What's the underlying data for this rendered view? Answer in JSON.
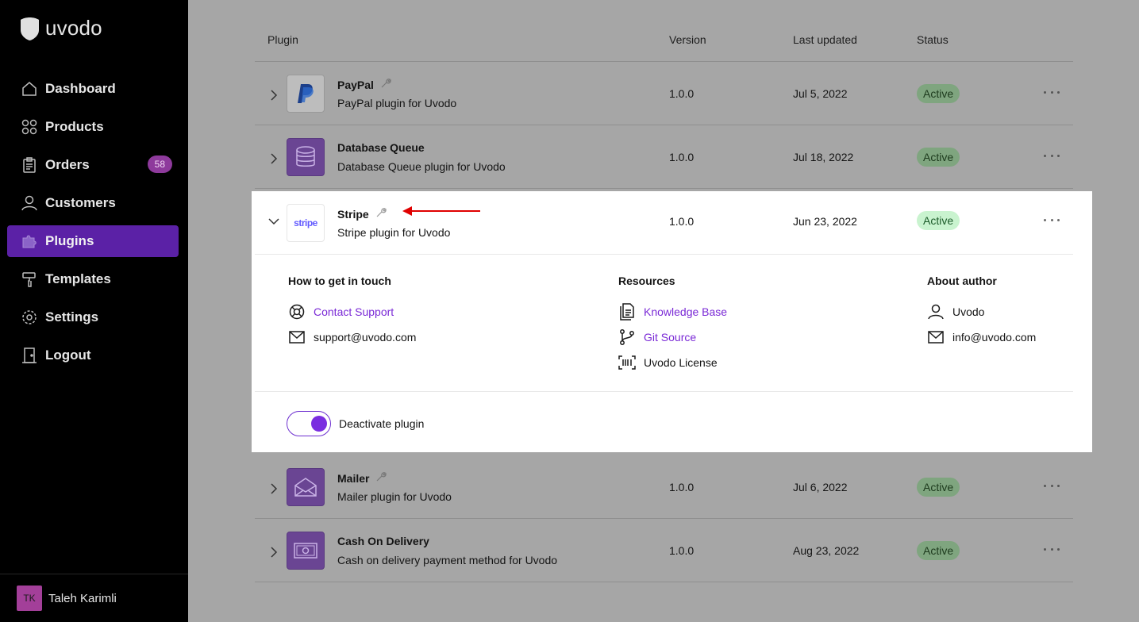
{
  "brand": {
    "name": "uvodo"
  },
  "nav": [
    {
      "label": "Dashboard",
      "icon": "home-icon"
    },
    {
      "label": "Products",
      "icon": "grid-icon"
    },
    {
      "label": "Orders",
      "icon": "clipboard-icon",
      "badge": "58"
    },
    {
      "label": "Customers",
      "icon": "user-icon"
    },
    {
      "label": "Plugins",
      "icon": "puzzle-icon",
      "active": true
    },
    {
      "label": "Templates",
      "icon": "paint-roller-icon"
    },
    {
      "label": "Settings",
      "icon": "gear-icon"
    },
    {
      "label": "Logout",
      "icon": "door-icon"
    }
  ],
  "user": {
    "initials": "TK",
    "name": "Taleh Karimli"
  },
  "table": {
    "headers": {
      "plugin": "Plugin",
      "version": "Version",
      "updated": "Last updated",
      "status": "Status"
    }
  },
  "plugins": [
    {
      "name": "PayPal",
      "desc": "PayPal plugin for Uvodo",
      "version": "1.0.0",
      "updated": "Jul 5, 2022",
      "status": "Active"
    },
    {
      "name": "Database Queue",
      "desc": "Database Queue plugin for Uvodo",
      "version": "1.0.0",
      "updated": "Jul 18, 2022",
      "status": "Active"
    },
    {
      "name": "Stripe",
      "desc": "Stripe plugin for Uvodo",
      "version": "1.0.0",
      "updated": "Jun 23, 2022",
      "status": "Active",
      "logo_text": "stripe"
    },
    {
      "name": "Mailer",
      "desc": "Mailer plugin for Uvodo",
      "version": "1.0.0",
      "updated": "Jul 6, 2022",
      "status": "Active"
    },
    {
      "name": "Cash On Delivery",
      "desc": "Cash on delivery payment method for Uvodo",
      "version": "1.0.0",
      "updated": "Aug 23, 2022",
      "status": "Active"
    }
  ],
  "details": {
    "touch": {
      "title": "How to get in touch",
      "contact": "Contact Support",
      "email": "support@uvodo.com"
    },
    "resources": {
      "title": "Resources",
      "kb": "Knowledge Base",
      "git": "Git Source",
      "license": "Uvodo License"
    },
    "author": {
      "title": "About author",
      "name": "Uvodo",
      "email": "info@uvodo.com"
    },
    "toggle_label": "Deactivate plugin"
  },
  "colors": {
    "accent": "#5b21a6",
    "link": "#7a29d6",
    "active_badge": "#c9f3cf",
    "annotation_arrow": "#e00000"
  }
}
